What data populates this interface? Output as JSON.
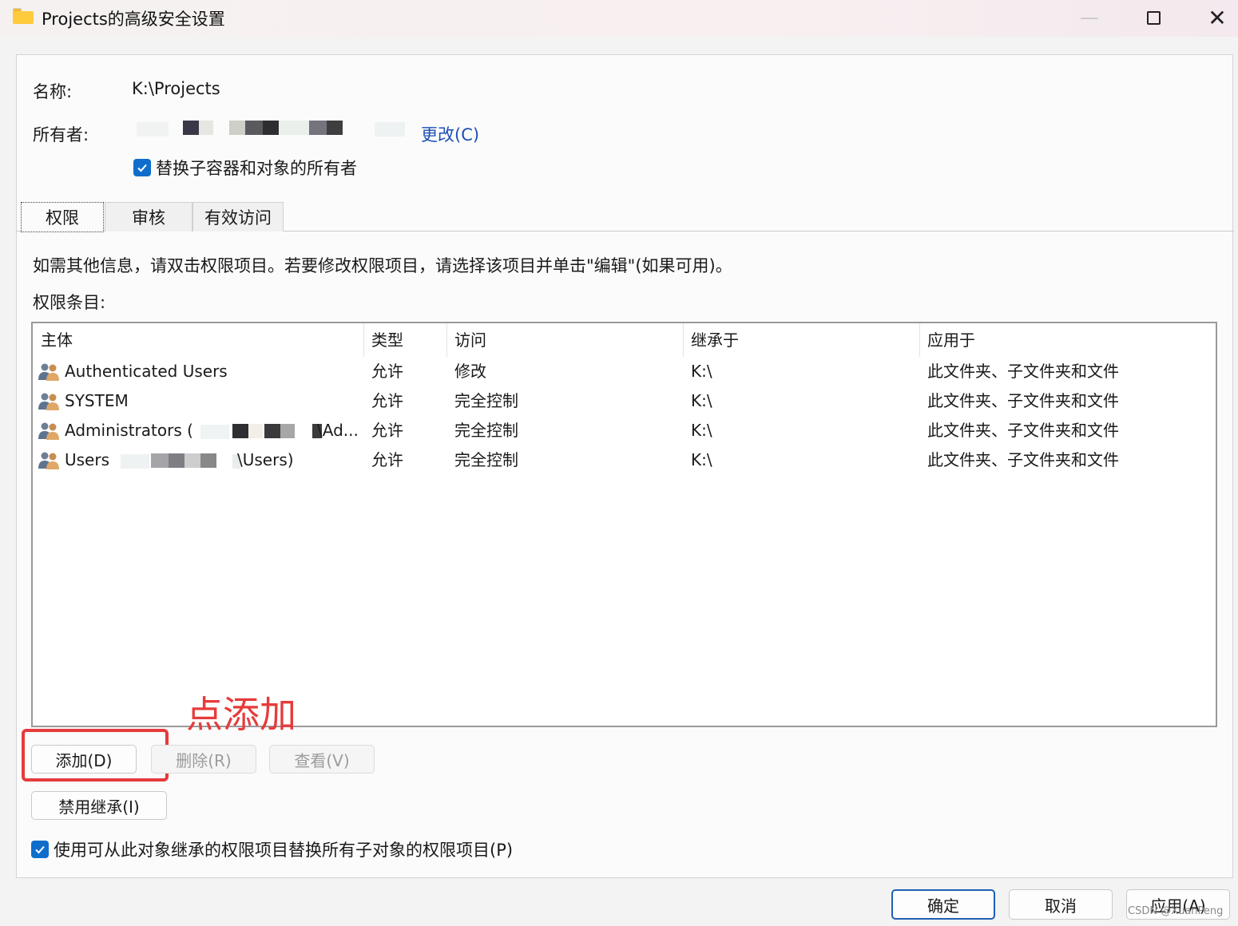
{
  "window": {
    "title": "Projects的高级安全设置",
    "minimize_icon": "minimize-icon",
    "maximize_icon": "maximize-icon",
    "close_icon": "close-icon",
    "close_glyph": "✕"
  },
  "owner_section": {
    "name_label": "名称:",
    "name_value": "K:\\Projects",
    "owner_label": "所有者:",
    "change_link": "更改(C)",
    "replace_owner_checkbox": {
      "label": "替换子容器和对象的所有者",
      "checked": true
    }
  },
  "tabs": [
    {
      "label": "权限",
      "active": true
    },
    {
      "label": "审核",
      "active": false
    },
    {
      "label": "有效访问",
      "active": false
    }
  ],
  "info_text": "如需其他信息，请双击权限项目。若要修改权限项目，请选择该项目并单击\"编辑\"(如果可用)。",
  "entries_label": "权限条目:",
  "table": {
    "columns": [
      "主体",
      "类型",
      "访问",
      "继承于",
      "应用于"
    ],
    "rows": [
      {
        "principal": "Authenticated Users",
        "type": "允许",
        "access": "修改",
        "inherited": "K:\\",
        "applies": "此文件夹、子文件夹和文件"
      },
      {
        "principal": "SYSTEM",
        "type": "允许",
        "access": "完全控制",
        "inherited": "K:\\",
        "applies": "此文件夹、子文件夹和文件"
      },
      {
        "principal": "Administrators (",
        "principal_suffix": "\\Ad...",
        "type": "允许",
        "access": "完全控制",
        "inherited": "K:\\",
        "applies": "此文件夹、子文件夹和文件"
      },
      {
        "principal": "Users",
        "principal_suffix": "\\Users)",
        "type": "允许",
        "access": "完全控制",
        "inherited": "K:\\",
        "applies": "此文件夹、子文件夹和文件"
      }
    ]
  },
  "buttons": {
    "add": "添加(D)",
    "remove": "删除(R)",
    "view": "查看(V)",
    "disable_inheritance": "禁用继承(I)",
    "ok": "确定",
    "cancel": "取消",
    "apply": "应用(A)"
  },
  "replace_child_checkbox": {
    "label": "使用可从此对象继承的权限项目替换所有子对象的权限项目(P)",
    "checked": true
  },
  "annotation": {
    "text": "点添加",
    "color": "#e63b3b"
  },
  "watermark": "CSDN @XuanPeng",
  "colors": {
    "accent": "#0f6ecb",
    "link": "#1d4fb5",
    "annotation_red": "#e63b3b"
  }
}
